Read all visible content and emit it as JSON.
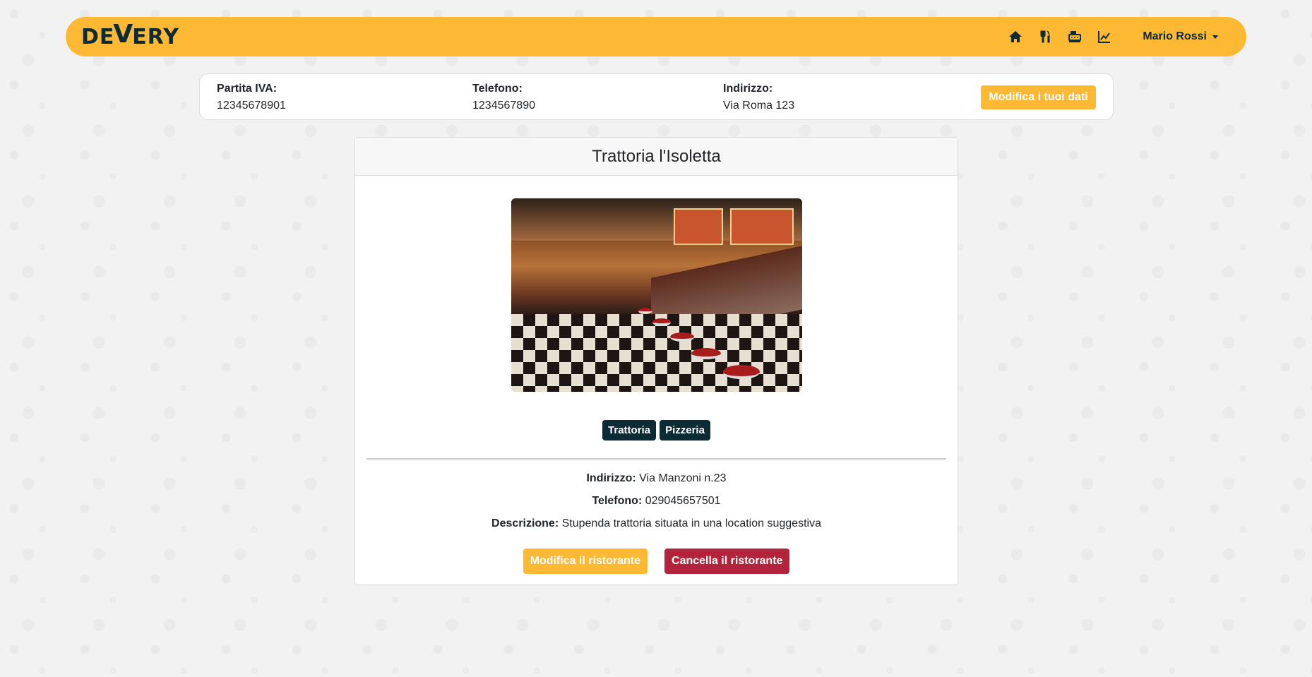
{
  "navbar": {
    "logo": {
      "part1": "DE",
      "part2": "V",
      "part3": "ERY"
    },
    "icons": [
      "home-icon",
      "utensils-icon",
      "cash-register-icon",
      "chart-line-icon"
    ],
    "user_name": "Mario Rossi"
  },
  "info": {
    "piva_label": "Partita IVA:",
    "piva_value": "12345678901",
    "phone_label": "Telefono:",
    "phone_value": "1234567890",
    "address_label": "Indirizzo:",
    "address_value": "Via Roma 123",
    "edit_button": "Modifica i tuoi dati"
  },
  "restaurant": {
    "name": "Trattoria l'Isoletta",
    "tags": [
      "Trattoria",
      "Pizzeria"
    ],
    "address_label": "Indirizzo:",
    "address_value": "Via Manzoni n.23",
    "phone_label": "Telefono:",
    "phone_value": "029045657501",
    "description_label": "Descrizione:",
    "description_value": "Stupenda trattoria situata in una location suggestiva",
    "edit_button": "Modifica il ristorante",
    "delete_button": "Cancella il ristorante"
  },
  "colors": {
    "accent": "#fdb933",
    "dark": "#0d2b35",
    "danger": "#b3233b"
  }
}
